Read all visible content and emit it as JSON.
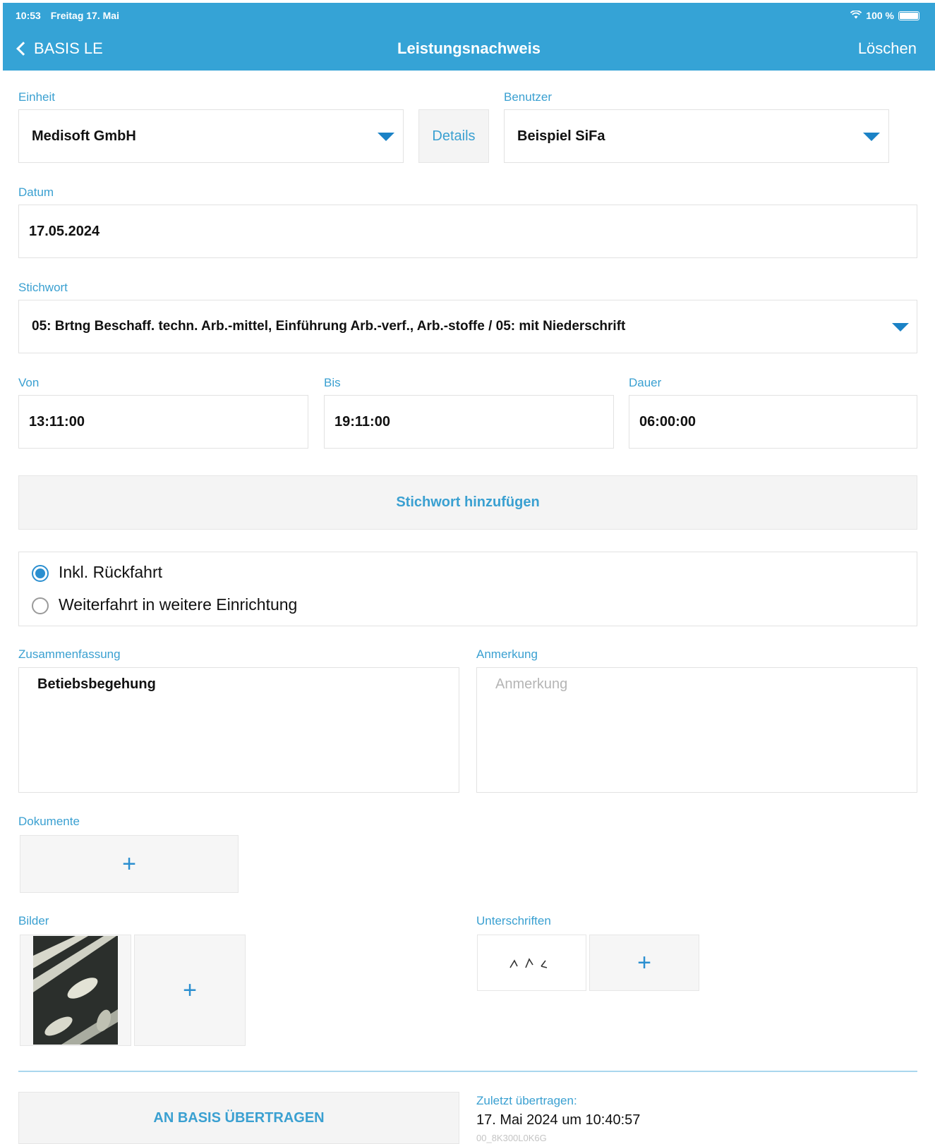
{
  "status_bar": {
    "time": "10:53",
    "date": "Freitag 17. Mai",
    "battery": "100 %"
  },
  "nav": {
    "back_label": "BASIS LE",
    "title": "Leistungsnachweis",
    "delete_label": "Löschen"
  },
  "form": {
    "einheit": {
      "label": "Einheit",
      "value": "Medisoft GmbH"
    },
    "details_label": "Details",
    "benutzer": {
      "label": "Benutzer",
      "value": "Beispiel SiFa"
    },
    "datum": {
      "label": "Datum",
      "value": "17.05.2024"
    },
    "stichwort": {
      "label": "Stichwort",
      "value": "05: Brtng Beschaff. techn. Arb.-mittel, Einführung Arb.-verf., Arb.-stoffe / 05: mit Niederschrift"
    },
    "von": {
      "label": "Von",
      "value": "13:11:00"
    },
    "bis": {
      "label": "Bis",
      "value": "19:11:00"
    },
    "dauer": {
      "label": "Dauer",
      "value": "06:00:00"
    },
    "add_keyword_label": "Stichwort hinzufügen",
    "radio": [
      {
        "label": "Inkl. Rückfahrt",
        "selected": true
      },
      {
        "label": "Weiterfahrt in weitere Einrichtung",
        "selected": false
      }
    ],
    "zusammenfassung": {
      "label": "Zusammenfassung",
      "value": "Betiebsbegehung"
    },
    "anmerkung": {
      "label": "Anmerkung",
      "placeholder": "Anmerkung"
    },
    "dokumente_label": "Dokumente",
    "bilder_label": "Bilder",
    "unterschriften_label": "Unterschriften"
  },
  "footer": {
    "transfer_label": "AN BASIS ÜBERTRAGEN",
    "last_transfer_label": "Zuletzt übertragen:",
    "last_transfer_value": "17. Mai 2024 um 10:40:57",
    "device_id": "00_8K300L0K6G"
  },
  "colors": {
    "header": "#35a3d6",
    "accent": "#2b8fd0",
    "label": "#3aa0d1"
  }
}
